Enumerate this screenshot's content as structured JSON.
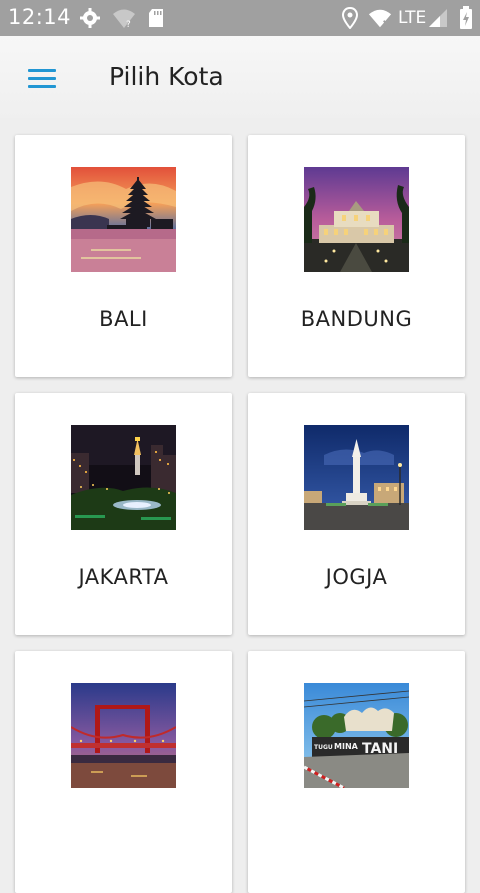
{
  "status_bar": {
    "time": "12:14",
    "network_label": "LTE",
    "icons": [
      "settings-icon",
      "wifi-question-icon",
      "sd-card-icon",
      "location-icon",
      "wifi-icon",
      "signal-icon",
      "battery-icon"
    ]
  },
  "app_bar": {
    "title": "Pilih Kota",
    "menu_icon": "hamburger-menu-icon",
    "accent_color": "#2196d3"
  },
  "cities": [
    {
      "name": "BALI",
      "image": "bali-temple-image"
    },
    {
      "name": "BANDUNG",
      "image": "bandung-building-image"
    },
    {
      "name": "JAKARTA",
      "image": "jakarta-monas-image"
    },
    {
      "name": "JOGJA",
      "image": "jogja-tugu-image"
    },
    {
      "name": "",
      "image": "palembang-bridge-image"
    },
    {
      "name": "",
      "image": "mina-tani-monument-image"
    }
  ]
}
